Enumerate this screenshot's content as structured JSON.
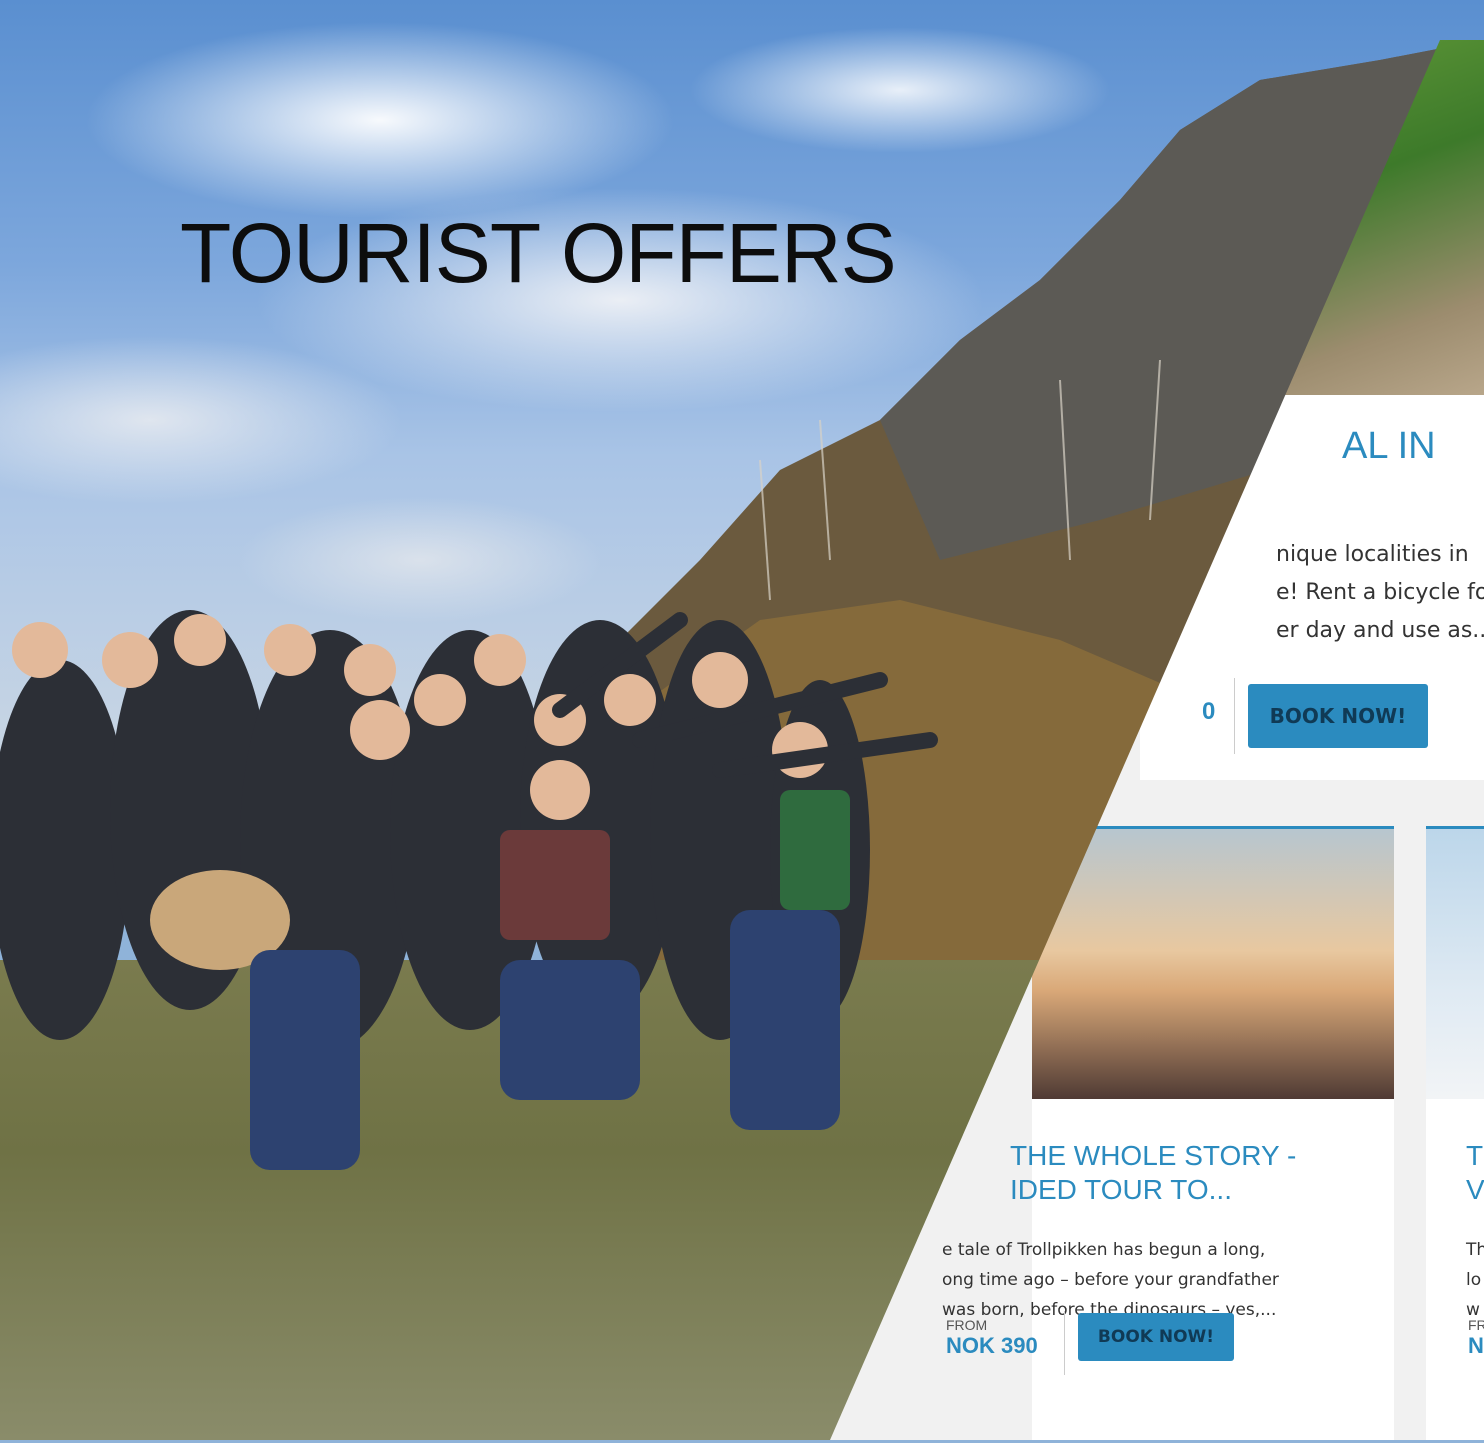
{
  "hero": {
    "title": "TOURIST OFFERS"
  },
  "offers": [
    {
      "title": "AL IN",
      "description": "nique localities in ...e! Rent a bicycle fo... er day and use as...",
      "description_lines": [
        "nique localities in",
        "e! Rent a bicycle fo",
        "er day and use as..."
      ],
      "price": "0",
      "button_label": "BOOK NOW!"
    },
    {
      "title_lines": [
        "THE WHOLE STORY -",
        "IDED TOUR TO..."
      ],
      "description_lines": [
        "e tale of Trollpikken  has begun a long,",
        "ong time ago – before your grandfather",
        "was born, before the dinosaurs – yes,..."
      ],
      "from_label": "FROM",
      "price": "NOK 390",
      "button_label": "BOOK NOW!"
    },
    {
      "title_lines": [
        "T",
        "V"
      ],
      "description_lines": [
        "Th",
        "lo",
        "w"
      ],
      "from_label": "FR",
      "price": "N"
    }
  ],
  "colors": {
    "accent": "#2b8bbf",
    "hero_text": "#0d0d0d"
  }
}
